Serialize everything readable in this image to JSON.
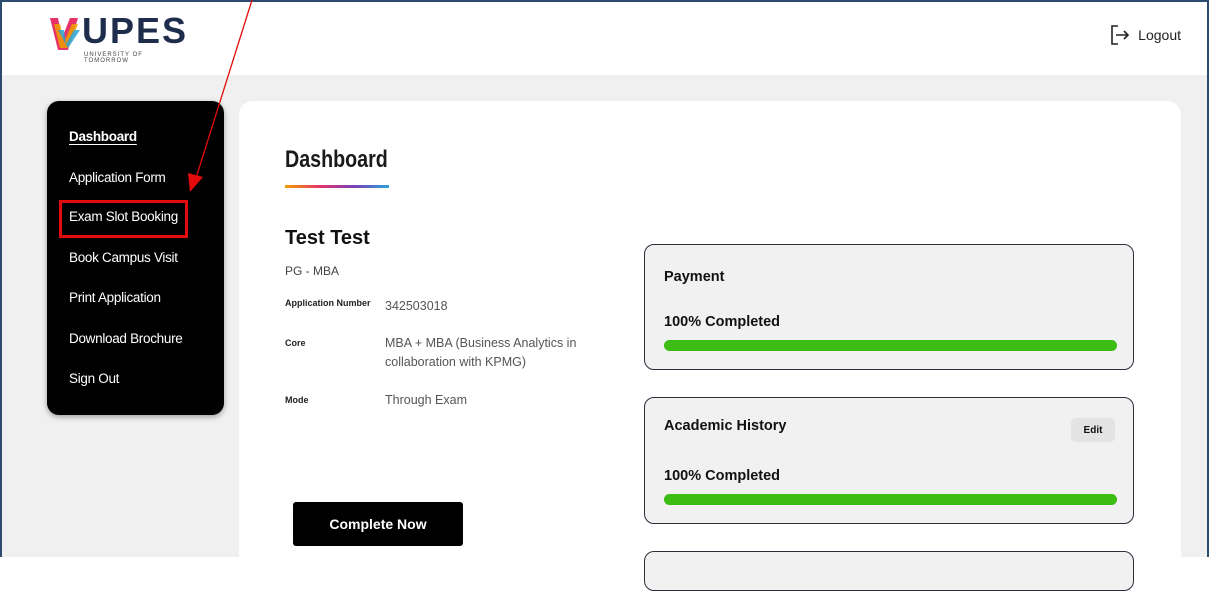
{
  "header": {
    "logo_text": "UPES",
    "logo_tagline": "UNIVERSITY OF TOMORROW",
    "logout_label": "Logout",
    "logout_icon": "logout-arrow-icon"
  },
  "sidebar": {
    "items": [
      {
        "label": "Dashboard",
        "active": true
      },
      {
        "label": "Application Form"
      },
      {
        "label": "Exam Slot Booking",
        "highlighted": true
      },
      {
        "label": "Book Campus Visit"
      },
      {
        "label": "Print Application"
      },
      {
        "label": "Download Brochure"
      },
      {
        "label": "Sign Out"
      }
    ]
  },
  "main": {
    "title": "Dashboard",
    "applicant": {
      "name": "Test Test",
      "program": "PG - MBA",
      "fields": [
        {
          "label": "Application Number",
          "value": "342503018"
        },
        {
          "label": "Core",
          "value_line1": "MBA + MBA (Business Analytics in",
          "value_line2": "collaboration with KPMG)"
        },
        {
          "label": "Mode",
          "value": "Through Exam"
        }
      ]
    },
    "complete_button": "Complete Now"
  },
  "cards": [
    {
      "title": "Payment",
      "progress_text": "100% Completed",
      "progress": 1.0
    },
    {
      "title": "Academic History",
      "progress_text": "100% Completed",
      "progress": 1.0,
      "edit_label": "Edit"
    }
  ],
  "colors": {
    "accent_progress": "#3bbd14",
    "annotation_red": "#e30b0b",
    "sidebar_bg": "#000000"
  }
}
